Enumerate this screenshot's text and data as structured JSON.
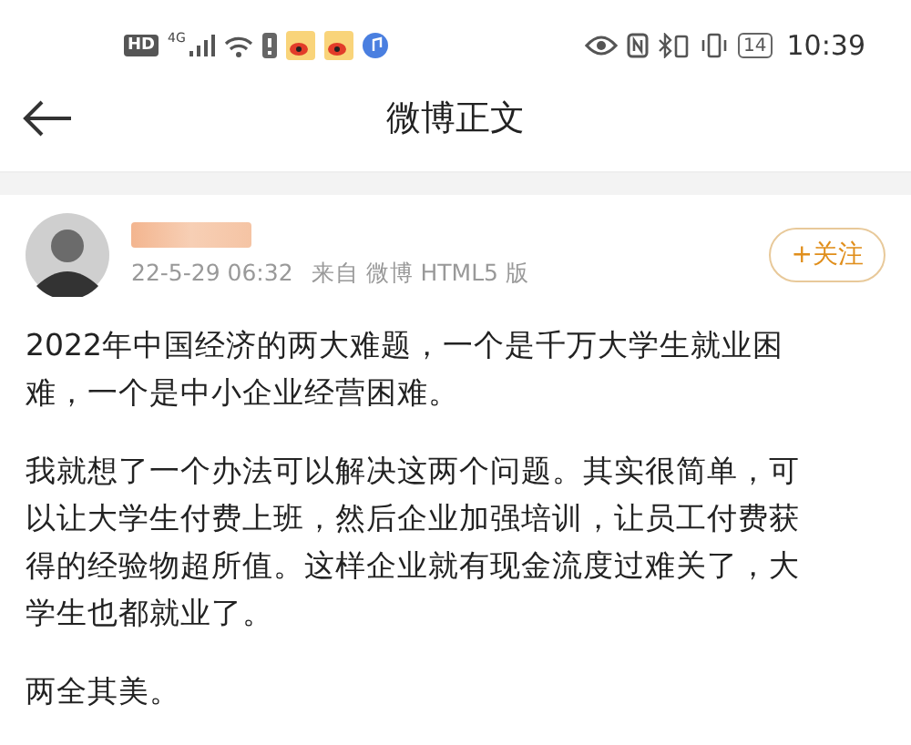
{
  "status_bar": {
    "hd_label": "HD",
    "network_label": "4G",
    "battery_level_text": "14",
    "time": "10:39"
  },
  "header": {
    "title": "微博正文"
  },
  "post": {
    "timestamp": "22-5-29 06:32",
    "source": "来自 微博 HTML5 版",
    "follow_button": "+关注",
    "paragraphs": [
      "2022年中国经济的两大难题，一个是千万大学生就业困难，一个是中小企业经营困难。",
      "我就想了一个办法可以解决这两个问题。其实很简单，可以让大学生付费上班，然后企业加强培训，让员工付费获得的经验物超所值。这样企业就有现金流度过难关了，大学生也都就业了。",
      "两全其美。"
    ]
  }
}
